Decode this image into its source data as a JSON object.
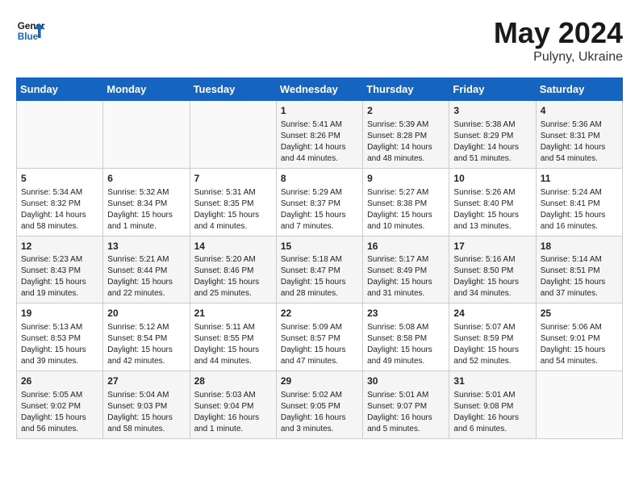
{
  "header": {
    "logo_line1": "General",
    "logo_line2": "Blue",
    "month_year": "May 2024",
    "location": "Pulyny, Ukraine"
  },
  "days_of_week": [
    "Sunday",
    "Monday",
    "Tuesday",
    "Wednesday",
    "Thursday",
    "Friday",
    "Saturday"
  ],
  "weeks": [
    [
      {
        "day": "",
        "content": ""
      },
      {
        "day": "",
        "content": ""
      },
      {
        "day": "",
        "content": ""
      },
      {
        "day": "1",
        "content": "Sunrise: 5:41 AM\nSunset: 8:26 PM\nDaylight: 14 hours\nand 44 minutes."
      },
      {
        "day": "2",
        "content": "Sunrise: 5:39 AM\nSunset: 8:28 PM\nDaylight: 14 hours\nand 48 minutes."
      },
      {
        "day": "3",
        "content": "Sunrise: 5:38 AM\nSunset: 8:29 PM\nDaylight: 14 hours\nand 51 minutes."
      },
      {
        "day": "4",
        "content": "Sunrise: 5:36 AM\nSunset: 8:31 PM\nDaylight: 14 hours\nand 54 minutes."
      }
    ],
    [
      {
        "day": "5",
        "content": "Sunrise: 5:34 AM\nSunset: 8:32 PM\nDaylight: 14 hours\nand 58 minutes."
      },
      {
        "day": "6",
        "content": "Sunrise: 5:32 AM\nSunset: 8:34 PM\nDaylight: 15 hours\nand 1 minute."
      },
      {
        "day": "7",
        "content": "Sunrise: 5:31 AM\nSunset: 8:35 PM\nDaylight: 15 hours\nand 4 minutes."
      },
      {
        "day": "8",
        "content": "Sunrise: 5:29 AM\nSunset: 8:37 PM\nDaylight: 15 hours\nand 7 minutes."
      },
      {
        "day": "9",
        "content": "Sunrise: 5:27 AM\nSunset: 8:38 PM\nDaylight: 15 hours\nand 10 minutes."
      },
      {
        "day": "10",
        "content": "Sunrise: 5:26 AM\nSunset: 8:40 PM\nDaylight: 15 hours\nand 13 minutes."
      },
      {
        "day": "11",
        "content": "Sunrise: 5:24 AM\nSunset: 8:41 PM\nDaylight: 15 hours\nand 16 minutes."
      }
    ],
    [
      {
        "day": "12",
        "content": "Sunrise: 5:23 AM\nSunset: 8:43 PM\nDaylight: 15 hours\nand 19 minutes."
      },
      {
        "day": "13",
        "content": "Sunrise: 5:21 AM\nSunset: 8:44 PM\nDaylight: 15 hours\nand 22 minutes."
      },
      {
        "day": "14",
        "content": "Sunrise: 5:20 AM\nSunset: 8:46 PM\nDaylight: 15 hours\nand 25 minutes."
      },
      {
        "day": "15",
        "content": "Sunrise: 5:18 AM\nSunset: 8:47 PM\nDaylight: 15 hours\nand 28 minutes."
      },
      {
        "day": "16",
        "content": "Sunrise: 5:17 AM\nSunset: 8:49 PM\nDaylight: 15 hours\nand 31 minutes."
      },
      {
        "day": "17",
        "content": "Sunrise: 5:16 AM\nSunset: 8:50 PM\nDaylight: 15 hours\nand 34 minutes."
      },
      {
        "day": "18",
        "content": "Sunrise: 5:14 AM\nSunset: 8:51 PM\nDaylight: 15 hours\nand 37 minutes."
      }
    ],
    [
      {
        "day": "19",
        "content": "Sunrise: 5:13 AM\nSunset: 8:53 PM\nDaylight: 15 hours\nand 39 minutes."
      },
      {
        "day": "20",
        "content": "Sunrise: 5:12 AM\nSunset: 8:54 PM\nDaylight: 15 hours\nand 42 minutes."
      },
      {
        "day": "21",
        "content": "Sunrise: 5:11 AM\nSunset: 8:55 PM\nDaylight: 15 hours\nand 44 minutes."
      },
      {
        "day": "22",
        "content": "Sunrise: 5:09 AM\nSunset: 8:57 PM\nDaylight: 15 hours\nand 47 minutes."
      },
      {
        "day": "23",
        "content": "Sunrise: 5:08 AM\nSunset: 8:58 PM\nDaylight: 15 hours\nand 49 minutes."
      },
      {
        "day": "24",
        "content": "Sunrise: 5:07 AM\nSunset: 8:59 PM\nDaylight: 15 hours\nand 52 minutes."
      },
      {
        "day": "25",
        "content": "Sunrise: 5:06 AM\nSunset: 9:01 PM\nDaylight: 15 hours\nand 54 minutes."
      }
    ],
    [
      {
        "day": "26",
        "content": "Sunrise: 5:05 AM\nSunset: 9:02 PM\nDaylight: 15 hours\nand 56 minutes."
      },
      {
        "day": "27",
        "content": "Sunrise: 5:04 AM\nSunset: 9:03 PM\nDaylight: 15 hours\nand 58 minutes."
      },
      {
        "day": "28",
        "content": "Sunrise: 5:03 AM\nSunset: 9:04 PM\nDaylight: 16 hours\nand 1 minute."
      },
      {
        "day": "29",
        "content": "Sunrise: 5:02 AM\nSunset: 9:05 PM\nDaylight: 16 hours\nand 3 minutes."
      },
      {
        "day": "30",
        "content": "Sunrise: 5:01 AM\nSunset: 9:07 PM\nDaylight: 16 hours\nand 5 minutes."
      },
      {
        "day": "31",
        "content": "Sunrise: 5:01 AM\nSunset: 9:08 PM\nDaylight: 16 hours\nand 6 minutes."
      },
      {
        "day": "",
        "content": ""
      }
    ]
  ]
}
